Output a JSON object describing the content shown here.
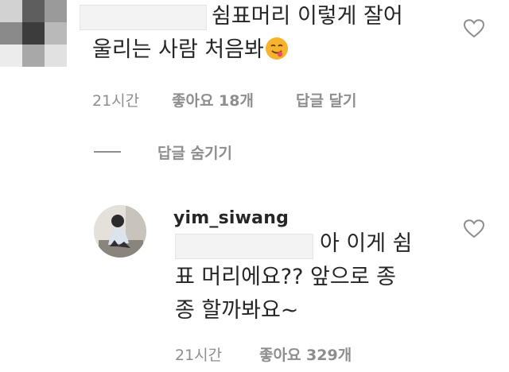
{
  "comment1": {
    "text_line1": "쉼표머리 이렇게 잘어",
    "text_line2": "울리는 사람 처음봐",
    "emoji": "drooling-face",
    "time": "21시간",
    "likes": "좋아요 18개",
    "reply": "답글 달기"
  },
  "replies_toggle": {
    "label": "답글 숨기기"
  },
  "comment2": {
    "username": "yim_siwang",
    "text_line1": "아 이게 쉼",
    "text_line2": "표 머리에요?? 앞으로 종",
    "text_line3": "종 할까봐요~",
    "time": "21시간",
    "likes": "좋아요 329개"
  },
  "colors": {
    "text": "#262626",
    "meta": "#8e8e8e",
    "heart": "#8e8e8e"
  }
}
